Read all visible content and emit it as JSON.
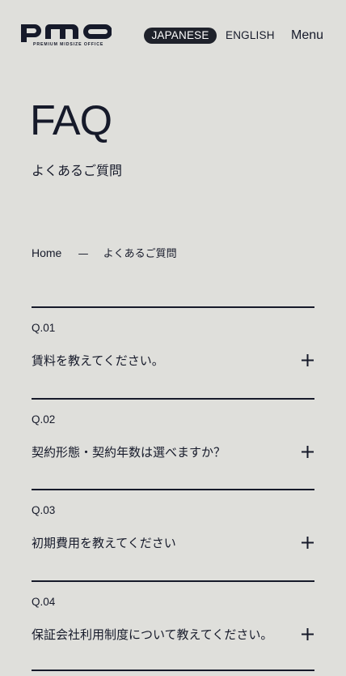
{
  "header": {
    "logo_wordmark": "pmo",
    "logo_tagline": "PREMIUM MIDSIZE OFFICE",
    "lang_japanese": "JAPANESE",
    "lang_english": "ENGLISH",
    "menu_label": "Menu"
  },
  "page": {
    "title": "FAQ",
    "subtitle": "よくあるご質問"
  },
  "breadcrumb": {
    "home": "Home",
    "separator": "—",
    "current": "よくあるご質問"
  },
  "faq": {
    "items": [
      {
        "number": "Q.01",
        "question": "賃料を教えてください。"
      },
      {
        "number": "Q.02",
        "question": "契約形態・契約年数は選べますか？"
      },
      {
        "number": "Q.03",
        "question": "初期費用を教えてください"
      },
      {
        "number": "Q.04",
        "question": "保証会社利用制度について教えてください。"
      }
    ]
  },
  "icons": {
    "expand": "plus-icon"
  },
  "colors": {
    "background": "#dfdfdb",
    "text": "#161a2a",
    "active_lang_bg": "#1f222b",
    "active_lang_text": "#ffffff"
  }
}
